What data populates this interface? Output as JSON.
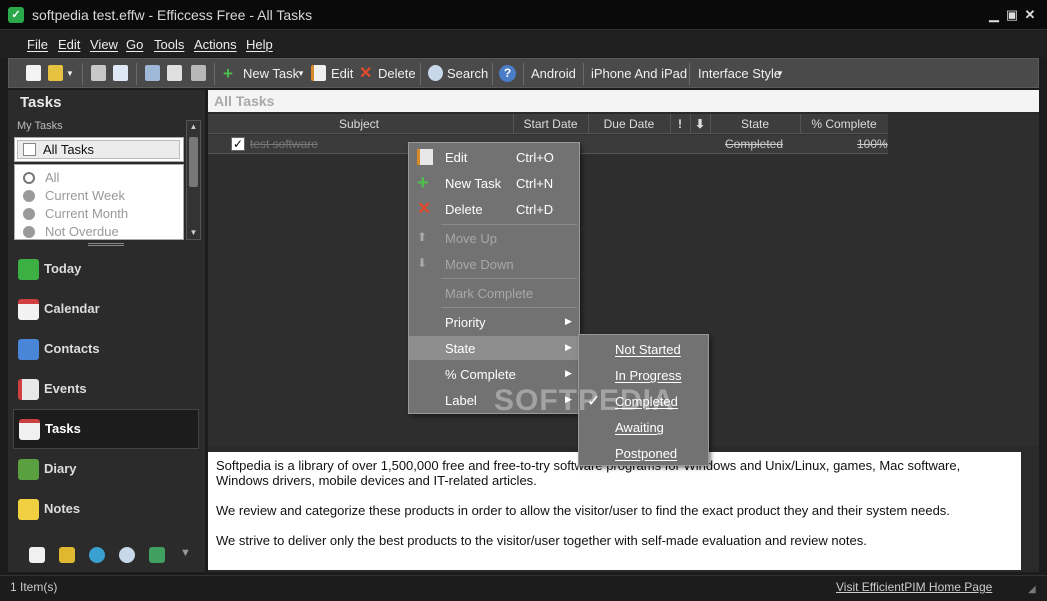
{
  "window": {
    "title": "softpedia test.effw - Efficcess Free - All Tasks"
  },
  "menu": [
    "File",
    "Edit",
    "View",
    "Go",
    "Tools",
    "Actions",
    "Help"
  ],
  "toolbar": {
    "new_task": "New Task",
    "edit": "Edit",
    "delete": "Delete",
    "search": "Search",
    "android": "Android",
    "iphone": "iPhone And iPad",
    "interface_style": "Interface Style"
  },
  "sidebar": {
    "header": "Tasks",
    "my_tasks_label": "My Tasks",
    "selected_list": "All Tasks",
    "filters": [
      "All",
      "Current Week",
      "Current Month",
      "Not Overdue"
    ],
    "nav": [
      "Today",
      "Calendar",
      "Contacts",
      "Events",
      "Tasks",
      "Diary",
      "Notes"
    ],
    "active_nav": "Tasks"
  },
  "main": {
    "header": "All Tasks",
    "columns": [
      "Subject",
      "Start Date",
      "Due Date",
      "!",
      "",
      "State",
      "% Complete"
    ],
    "rows": [
      {
        "subject": "test software",
        "state": "Completed",
        "complete": "100%"
      }
    ]
  },
  "context_menu": {
    "items": [
      {
        "label": "Edit",
        "shortcut": "Ctrl+O"
      },
      {
        "label": "New Task",
        "shortcut": "Ctrl+N"
      },
      {
        "label": "Delete",
        "shortcut": "Ctrl+D"
      },
      {
        "label": "Move Up",
        "shortcut": ""
      },
      {
        "label": "Move Down",
        "shortcut": ""
      },
      {
        "label": "Mark Complete",
        "shortcut": ""
      },
      {
        "label": "Priority",
        "shortcut": ""
      },
      {
        "label": "State",
        "shortcut": ""
      },
      {
        "label": "% Complete",
        "shortcut": ""
      },
      {
        "label": "Label",
        "shortcut": ""
      }
    ]
  },
  "state_submenu": [
    "Not Started",
    "In Progress",
    "Completed",
    "Awaiting",
    "Postponed"
  ],
  "state_checked": "Completed",
  "notes": {
    "p1": "Softpedia is a library of over 1,500,000 free and free-to-try software programs for Windows and Unix/Linux, games, Mac software, Windows drivers, mobile devices and IT-related articles.",
    "p2": "We review and categorize these products in order to allow the visitor/user to find the exact product they and their system needs.",
    "p3": "We strive to deliver only the best products to the visitor/user together with self-made evaluation and review notes."
  },
  "watermark": "SOFTPEDIA",
  "status": {
    "items": "1 Item(s)",
    "link": "Visit EfficientPIM Home Page"
  },
  "colors": {
    "accent_green": "#2aa84a",
    "delete_red": "#e04a2a"
  }
}
